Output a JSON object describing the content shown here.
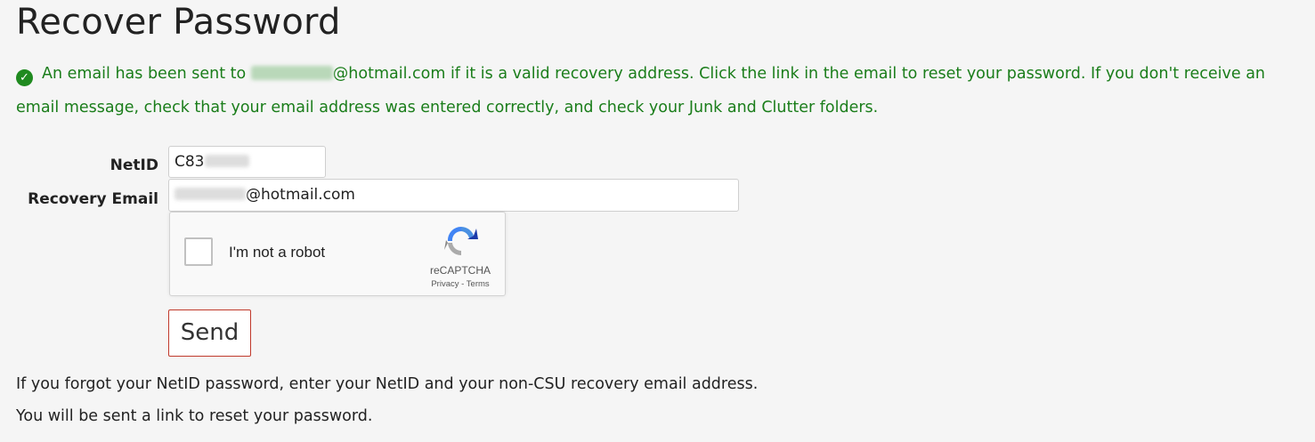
{
  "page": {
    "title": "Recover Password"
  },
  "alert": {
    "text_before": "An email has been sent to ",
    "email_domain": "@hotmail.com",
    "text_after": " if it is a valid recovery address. Click the link in the email to reset your password. If you don't receive an email message, check that your email address was entered correctly, and check your Junk and Clutter folders.",
    "icon": "check-circle-icon",
    "color": "#1a7d1a"
  },
  "form": {
    "netid_label": "NetID",
    "netid_value": "C83",
    "recovery_email_label": "Recovery Email",
    "recovery_email_value": "@hotmail.com",
    "send_label": "Send",
    "send_border_color": "#c0392b"
  },
  "captcha": {
    "label": "I'm not a robot",
    "brand": "reCAPTCHA",
    "privacy": "Privacy",
    "separator": " - ",
    "terms": "Terms"
  },
  "help": {
    "line1": "If you forgot your NetID password, enter your NetID and your non-CSU recovery email address.",
    "line2": "You will be sent a link to reset your password."
  }
}
